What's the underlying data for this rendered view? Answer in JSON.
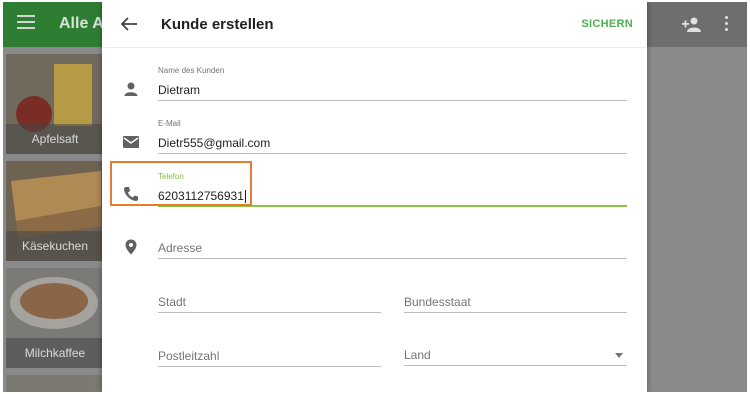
{
  "background": {
    "app_title": "Alle Ar",
    "tiles": [
      {
        "label": "Apfelsaft"
      },
      {
        "label": "Käsekuchen"
      },
      {
        "label": "Milchkaffee"
      }
    ]
  },
  "dialog": {
    "title": "Kunde erstellen",
    "save_label": "SICHERN",
    "fields": {
      "name": {
        "label": "Name des Kunden",
        "value": "Dietram"
      },
      "email": {
        "label": "E-Mail",
        "value": "Dietr555@gmail.com"
      },
      "phone": {
        "label": "Telefon",
        "value": "6203112756931"
      },
      "address": {
        "placeholder": "Adresse"
      },
      "city": {
        "placeholder": "Stadt"
      },
      "state": {
        "placeholder": "Bundesstaat"
      },
      "zip": {
        "placeholder": "Postleitzahl"
      },
      "country": {
        "placeholder": "Land"
      }
    }
  },
  "colors": {
    "accent": "#8bc34a",
    "save": "#4caf50",
    "highlight": "#e87c2c",
    "appbar": "#2e7d32"
  },
  "icons": [
    "menu-icon",
    "add-person-icon",
    "more-vert-icon",
    "back-arrow-icon",
    "person-icon",
    "email-icon",
    "phone-icon",
    "location-icon",
    "dropdown-arrow-icon"
  ]
}
